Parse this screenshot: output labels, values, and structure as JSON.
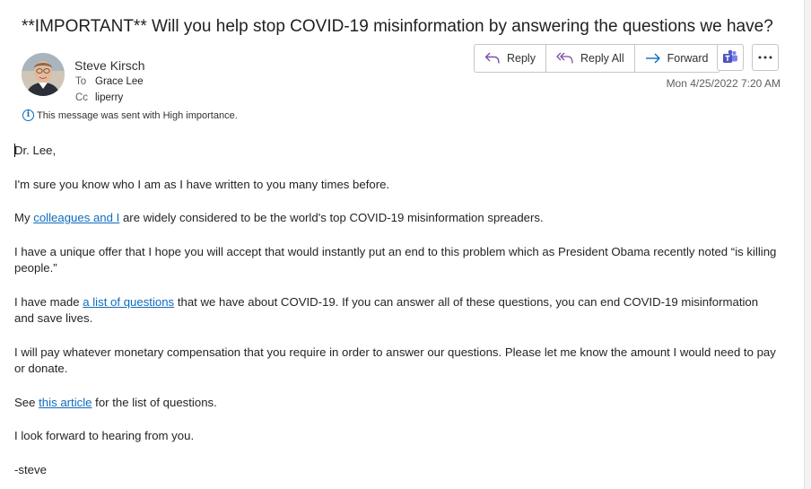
{
  "email": {
    "subject": "**IMPORTANT** Will you help stop COVID-19 misinformation by answering the questions we have?",
    "sender_name": "Steve Kirsch",
    "to_label": "To",
    "to_value": "Grace Lee",
    "cc_label": "Cc",
    "cc_value": "liperry",
    "importance_note": "This message was sent with High importance.",
    "date": "Mon 4/25/2022 7:20 AM"
  },
  "actions": {
    "reply": "Reply",
    "reply_all": "Reply All",
    "forward": "Forward"
  },
  "icons": {
    "reply": "reply-icon",
    "reply_all": "reply-all-icon",
    "forward": "forward-arrow-icon",
    "teams": "teams-icon",
    "more": "more-ellipsis-icon",
    "info": "info-icon"
  },
  "colors": {
    "link": "#0f6cbd",
    "accent": "#0f6cbd",
    "teams": "#5059c9"
  },
  "body": {
    "greeting": "Dr. Lee,",
    "p1": "I'm sure you know who I am as I have written to you many times before.",
    "p2_pre": "My ",
    "p2_link": "colleagues and I",
    "p2_post": " are widely considered to be the world's top COVID-19 misinformation spreaders.",
    "p3": "I have a unique offer that I hope you will accept that would instantly put an end to this problem which as President Obama recently noted “is killing people.”",
    "p4_pre": "I have made ",
    "p4_link": "a list of questions",
    "p4_post": " that we have about COVID-19. If you can answer all of these questions, you can end COVID-19 misinformation and save lives.",
    "p5": "I will pay whatever monetary compensation that you require in order to answer our questions. Please let me know the amount I would need to pay or donate.",
    "p6_pre": "See ",
    "p6_link": "this article",
    "p6_post": " for the list of questions.",
    "p7": "I look forward to hearing from you.",
    "signature": "-steve"
  }
}
